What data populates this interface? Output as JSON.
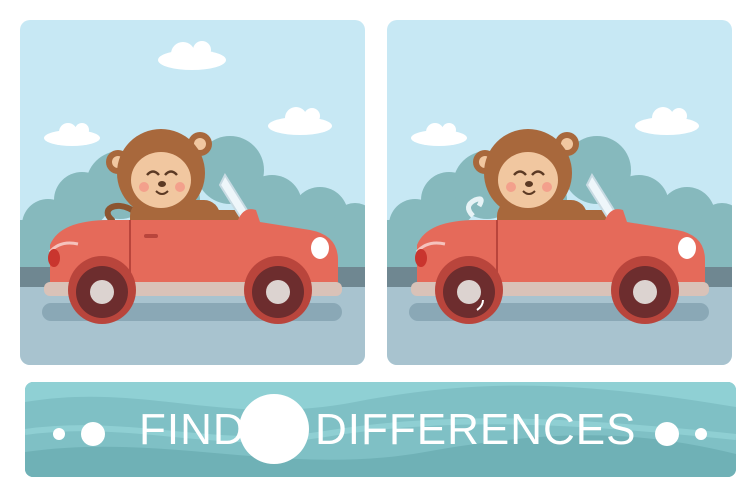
{
  "game": {
    "title_word_1": "FIND",
    "title_word_2": "DIFFERENCES"
  },
  "colors": {
    "sky": "#c7e8f4",
    "road": "#a8c3cf",
    "bush": "#86b9bd",
    "car_body": "#e56a5a",
    "car_dark": "#b9453c",
    "monkey_fur": "#a8683c",
    "monkey_face": "#f1c7a0",
    "banner": "#7fc0c5"
  },
  "scenes": [
    {
      "name": "left-picture",
      "tail_shown": true,
      "car_door_line": true
    },
    {
      "name": "right-picture",
      "tail_shown": false,
      "car_door_line": false
    }
  ]
}
